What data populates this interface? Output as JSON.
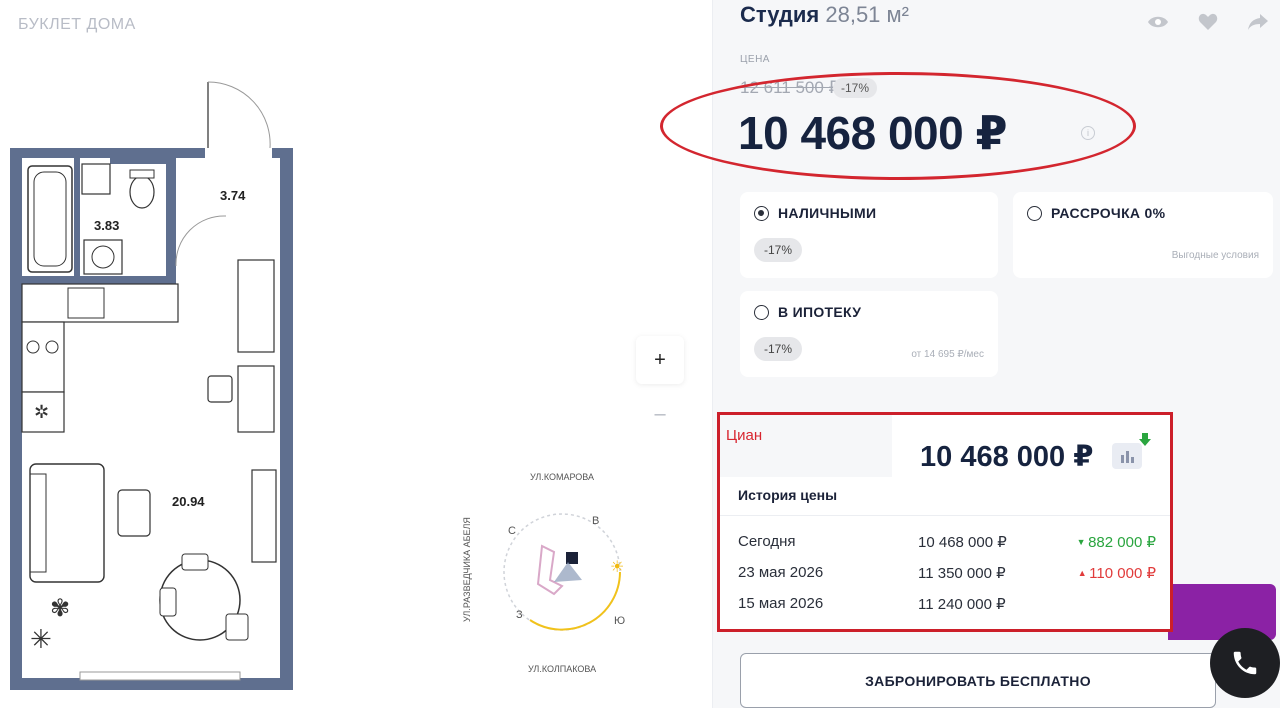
{
  "left": {
    "booklet_label": "БУКЛЕТ ДОМА",
    "rooms": [
      {
        "name": "bathroom",
        "area": "3.83"
      },
      {
        "name": "hallway",
        "area": "3.74"
      },
      {
        "name": "living",
        "area": "20.94"
      }
    ],
    "zoom_in": "+",
    "zoom_out": "–",
    "compass": {
      "street_top": "УЛ.КОМАРОВА",
      "street_bottom": "УЛ.КОЛПАКОВА",
      "street_left": "УЛ.РАЗВЕДЧИКА АБЕЛЯ",
      "north": "С",
      "east": "В",
      "south": "Ю",
      "west": "З"
    }
  },
  "header": {
    "type": "Студия",
    "area": "28,51 м²",
    "icons": [
      "eye-icon",
      "heart-icon",
      "share-icon"
    ]
  },
  "price": {
    "label": "ЦЕНА",
    "old_price": "12 611 500 ₽",
    "discount": "-17%",
    "current": "10 468 000 ₽"
  },
  "payment_options": [
    {
      "label": "НАЛИЧНЫМИ",
      "badge": "-17%",
      "note": "",
      "selected": true
    },
    {
      "label": "РАССРОЧКА 0%",
      "badge": "",
      "note": "Выгодные условия",
      "selected": false
    },
    {
      "label": "В ИПОТЕКУ",
      "badge": "-17%",
      "note": "от 14 695 ₽/мес",
      "selected": false
    }
  ],
  "cian": {
    "label": "Циан",
    "price": "10 468 000 ₽",
    "history_title": "История цены",
    "rows": [
      {
        "date": "Сегодня",
        "price": "10 468 000 ₽",
        "change": "882 000 ₽",
        "direction": "down"
      },
      {
        "date": "23 мая 2026",
        "price": "11 350 000 ₽",
        "change": "110 000 ₽",
        "direction": "up"
      },
      {
        "date": "15 мая 2026",
        "price": "11 240 000 ₽",
        "change": "",
        "direction": ""
      }
    ]
  },
  "actions": {
    "book": "ЗАБРОНИРОВАТЬ БЕСПЛАТНО"
  },
  "colors": {
    "accent_purple": "#8b22a5",
    "annotation_red": "#d3262f",
    "down_green": "#2aa53f",
    "up_red": "#e13b3b"
  }
}
